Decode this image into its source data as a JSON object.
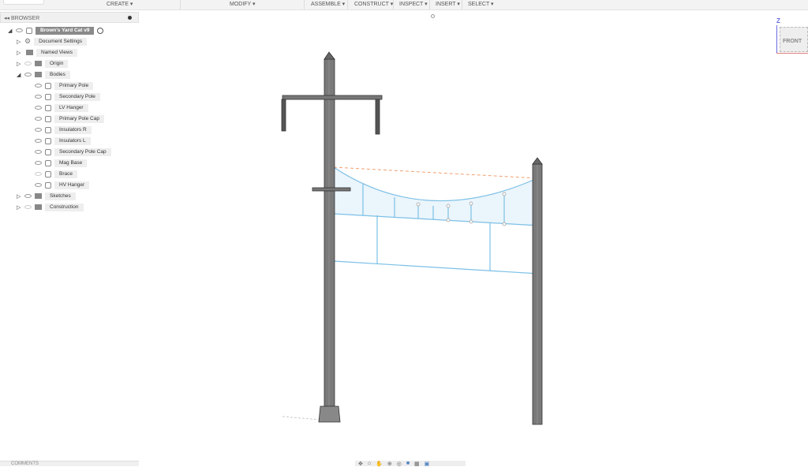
{
  "toolbar": {
    "menus": [
      "CREATE ▾",
      "MODIFY ▾",
      "ASSEMBLE ▾",
      "CONSTRUCT ▾",
      "INSPECT ▾",
      "INSERT ▾",
      "SELECT ▾"
    ]
  },
  "browser": {
    "title": "BROWSER",
    "root": "Brown's Yard Cat v9",
    "items": [
      {
        "label": "Document Settings"
      },
      {
        "label": "Named Views"
      },
      {
        "label": "Origin"
      },
      {
        "label": "Bodies"
      }
    ],
    "bodies": [
      "Primary Pole",
      "Secondary Pole",
      "LV Hanger",
      "Primary Pole Cap",
      "Insulators R",
      "Insulators L",
      "Secondary Pole Cap",
      "Mag Base",
      "Brace",
      "HV Hanger"
    ],
    "after": [
      {
        "label": "Sketches"
      },
      {
        "label": "Construction"
      }
    ]
  },
  "comments": {
    "title": "COMMENTS"
  },
  "viewcube": {
    "face": "FRONT",
    "axis_z": "Z"
  },
  "colors": {
    "sketch": "#7cc0e6",
    "pole": "#6f6f6f",
    "construction": "#f0a070"
  }
}
